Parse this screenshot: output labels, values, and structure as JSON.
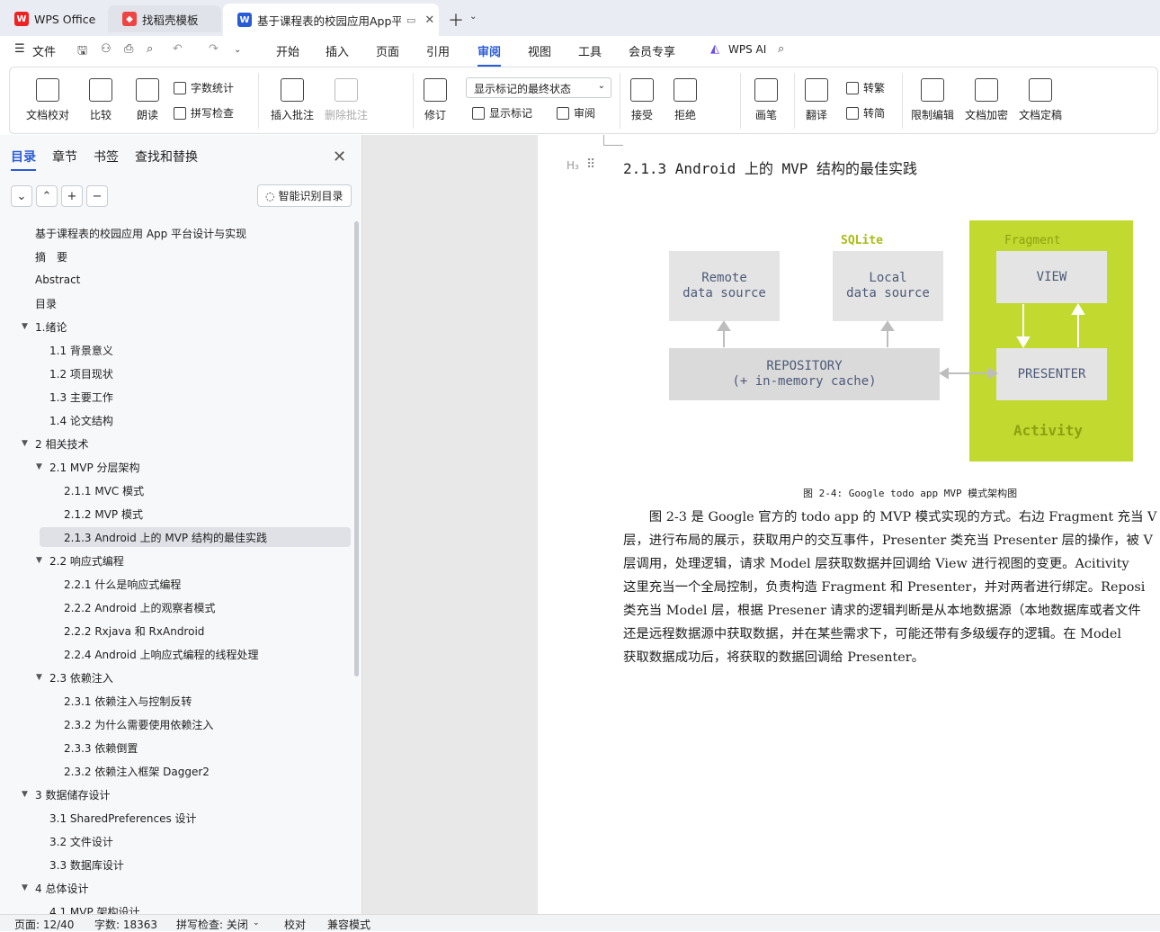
{
  "tabs": [
    {
      "label": "WPS Office"
    },
    {
      "label": "找稻壳模板"
    },
    {
      "label": "基于课程表的校园应用App平台设"
    }
  ],
  "menu": {
    "file": "文件",
    "items": [
      "开始",
      "插入",
      "页面",
      "引用",
      "审阅",
      "视图",
      "工具",
      "会员专享"
    ],
    "active": "审阅",
    "ai": "WPS AI"
  },
  "ribbon": {
    "doc_check": "文档校对",
    "compare": "比较",
    "read_aloud": "朗读",
    "word_count": "字数统计",
    "spell_check": "拼写检查",
    "insert_comment": "插入批注",
    "delete_comment": "删除批注",
    "revise": "修订",
    "markup_state": "显示标记的最终状态",
    "show_markup": "显示标记",
    "review": "审阅",
    "accept": "接受",
    "reject": "拒绝",
    "pen": "画笔",
    "translate": "翻译",
    "to_traditional": "转繁",
    "to_simplified": "转简",
    "restrict_edit": "限制编辑",
    "encrypt": "文档加密",
    "finalize": "文档定稿"
  },
  "sidebar": {
    "tabs": [
      "目录",
      "章节",
      "书签",
      "查找和替换"
    ],
    "smart_button": "智能识别目录",
    "toc": [
      {
        "label": "基于课程表的校园应用 App 平台设计与实现",
        "level": 0
      },
      {
        "label": "摘　要",
        "level": 0
      },
      {
        "label": "Abstract",
        "level": 0
      },
      {
        "label": "目录",
        "level": 0
      },
      {
        "label": "1.绪论",
        "level": 0,
        "expandable": true
      },
      {
        "label": "1.1  背景意义",
        "level": 1
      },
      {
        "label": "1.2  项目现状",
        "level": 1
      },
      {
        "label": "1.3  主要工作",
        "level": 1
      },
      {
        "label": "1.4  论文结构",
        "level": 1
      },
      {
        "label": "2  相关技术",
        "level": 0,
        "expandable": true
      },
      {
        "label": "2.1 MVP 分层架构",
        "level": 1,
        "expandable": true
      },
      {
        "label": "2.1.1 MVC 模式",
        "level": 2
      },
      {
        "label": "2.1.2 MVP 模式",
        "level": 2
      },
      {
        "label": "2.1.3 Android 上的 MVP 结构的最佳实践",
        "level": 2,
        "selected": true
      },
      {
        "label": "2.2  响应式编程",
        "level": 1,
        "expandable": true
      },
      {
        "label": "2.2.1  什么是响应式编程",
        "level": 2
      },
      {
        "label": "2.2.2 Android 上的观察者模式",
        "level": 2
      },
      {
        "label": "2.2.2 Rxjava 和 RxAndroid",
        "level": 2
      },
      {
        "label": "2.2.4 Android 上响应式编程的线程处理",
        "level": 2
      },
      {
        "label": "2.3  依赖注入",
        "level": 1,
        "expandable": true
      },
      {
        "label": "2.3.1 依赖注入与控制反转",
        "level": 2
      },
      {
        "label": "2.3.2 为什么需要使用依赖注入",
        "level": 2
      },
      {
        "label": "2.3.3  依赖倒置",
        "level": 2
      },
      {
        "label": "2.3.2  依赖注入框架 Dagger2",
        "level": 2
      },
      {
        "label": "3  数据储存设计",
        "level": 0,
        "expandable": true
      },
      {
        "label": "3.1 SharedPreferences 设计",
        "level": 1
      },
      {
        "label": "3.2  文件设计",
        "level": 1
      },
      {
        "label": "3.3  数据库设计",
        "level": 1
      },
      {
        "label": "4  总体设计",
        "level": 0,
        "expandable": true
      },
      {
        "label": "4.1 MVP 架构设计",
        "level": 1
      }
    ]
  },
  "document": {
    "heading_mark": "H₃",
    "heading": "2.1.3 Android 上的 MVP 结构的最佳实践",
    "diagram": {
      "sqlite_label": "SQLite",
      "fragment_label": "Fragment",
      "remote": "Remote\ndata source",
      "local": "Local\ndata source",
      "view": "VIEW",
      "presenter": "PRESENTER",
      "repository": "REPOSITORY\n(+ in-memory cache)",
      "activity": "Activity"
    },
    "caption": "图 2-4: Google todo app MVP 模式架构图",
    "paragraph": [
      "　　图 2-3 是 Google 官方的 todo app 的 MVP 模式实现的方式。右边 Fragment 充当 V",
      "层，进行布局的展示，获取用户的交互事件，Presenter 类充当 Presenter 层的操作，被 V",
      "层调用，处理逻辑，请求 Model 层获取数据并回调给 View 进行视图的变更。Acitivity",
      "这里充当一个全局控制，负责构造 Fragment 和 Presenter，并对两者进行绑定。Reposi",
      "类充当 Model 层，根据 Presener 请求的逻辑判断是从本地数据源（本地数据库或者文件",
      "还是远程数据源中获取数据，并在某些需求下，可能还带有多级缓存的逻辑。在 Model",
      "获取数据成功后，将获取的数据回调给 Presenter。"
    ]
  },
  "status": {
    "page": "页面: 12/40",
    "words": "字数: 18363",
    "spell": "拼写检查: 关闭",
    "proof": "校对",
    "compat": "兼容模式"
  },
  "colors": {
    "accent": "#2a5bd7",
    "lime": "#c2d92f",
    "box_text": "#4c5a78"
  }
}
